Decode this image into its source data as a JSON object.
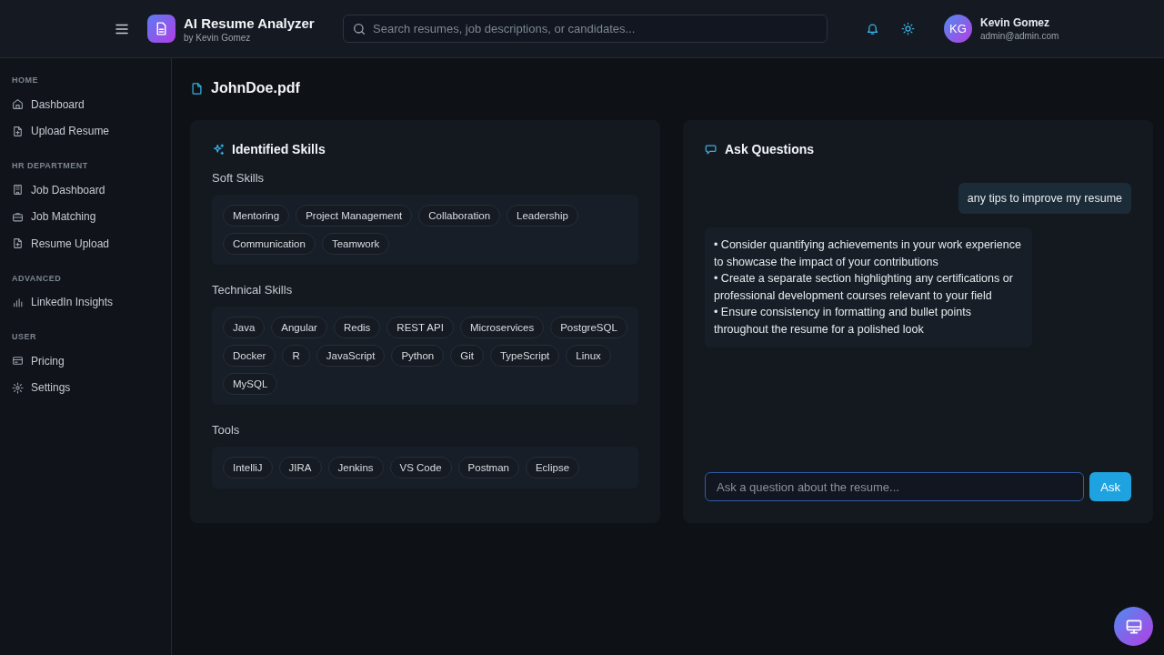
{
  "header": {
    "app_title": "AI Resume Analyzer",
    "app_subtitle": "by Kevin Gomez",
    "search": {
      "placeholder": "Search resumes, job descriptions, or candidates..."
    },
    "user": {
      "initials": "KG",
      "name": "Kevin Gomez",
      "email": "admin@admin.com"
    }
  },
  "sidebar": {
    "sections": [
      {
        "heading": "HOME",
        "items": [
          {
            "label": "Dashboard",
            "kind": "home"
          },
          {
            "label": "Upload Resume",
            "kind": "file"
          }
        ]
      },
      {
        "heading": "HR DEPARTMENT",
        "items": [
          {
            "label": "Job Dashboard",
            "kind": "building"
          },
          {
            "label": "Job Matching",
            "kind": "briefcase"
          },
          {
            "label": "Resume Upload",
            "kind": "file"
          }
        ]
      },
      {
        "heading": "ADVANCED",
        "items": [
          {
            "label": "LinkedIn Insights",
            "kind": "chart"
          }
        ]
      },
      {
        "heading": "USER",
        "items": [
          {
            "label": "Pricing",
            "kind": "card"
          },
          {
            "label": "Settings",
            "kind": "gear"
          }
        ]
      }
    ]
  },
  "page": {
    "title": "JohnDoe.pdf"
  },
  "skills_card": {
    "title": "Identified Skills",
    "groups": [
      {
        "heading": "Soft Skills",
        "skills": [
          "Mentoring",
          "Project Management",
          "Collaboration",
          "Leadership",
          "Communication",
          "Teamwork"
        ]
      },
      {
        "heading": "Technical Skills",
        "skills": [
          "Java",
          "Angular",
          "Redis",
          "REST API",
          "Microservices",
          "PostgreSQL",
          "Docker",
          "R",
          "JavaScript",
          "Python",
          "Git",
          "TypeScript",
          "Linux",
          "MySQL"
        ]
      },
      {
        "heading": "Tools",
        "skills": [
          "IntelliJ",
          "JIRA",
          "Jenkins",
          "VS Code",
          "Postman",
          "Eclipse"
        ]
      }
    ]
  },
  "questions_card": {
    "title": "Ask Questions",
    "messages": [
      {
        "kind": "user",
        "lines": [
          "any tips to improve my resume"
        ]
      },
      {
        "kind": "answer",
        "lines": [
          "• Consider quantifying achievements in your work experience to showcase the impact of your contributions",
          "• Create a separate section highlighting any certifications or professional development courses relevant to your field",
          "• Ensure consistency in formatting and bullet points throughout the resume for a polished look"
        ]
      }
    ],
    "input": {
      "placeholder": "Ask a question about the resume..."
    },
    "ask_button": "Ask"
  }
}
